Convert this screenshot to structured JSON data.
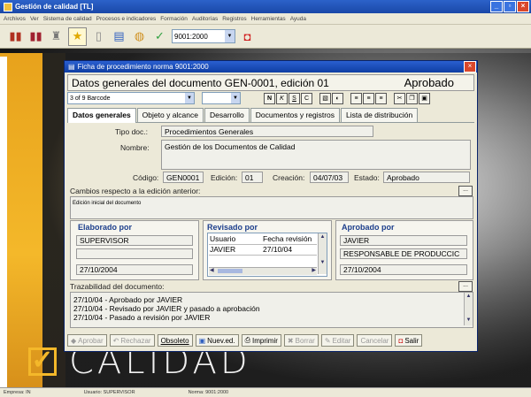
{
  "app": {
    "title": "Gestión de calidad [TL]",
    "menu": [
      "Archivos",
      "Ver",
      "Sistema de calidad",
      "Procesos e indicadores",
      "Formación",
      "Auditorías",
      "Registros",
      "Herramientas",
      "Ayuda"
    ],
    "toolbar_combo": "9001:2000",
    "status": [
      "Empresa: IN",
      "Usuario: SUPERVISOR",
      "Norma: 9001:2000"
    ],
    "brand_word": "CALIDAD",
    "accent": "#f4b82a"
  },
  "dialog": {
    "title": "Ficha de procedimiento norma 9001:2000",
    "heading": "Datos generales del documento GEN-0001, edición 01",
    "status": "Aprobado",
    "font_combo": "3 of 9 Barcode",
    "format_buttons": [
      "N",
      "K",
      "S",
      "C"
    ],
    "tabs": [
      "Datos generales",
      "Objeto y alcance",
      "Desarrollo",
      "Documentos y registros",
      "Lista de distribución"
    ],
    "fields": {
      "tipo_label": "Tipo doc.:",
      "tipo_value": "Procedimientos Generales",
      "nombre_label": "Nombre:",
      "nombre_value": "Gestión de los Documentos de Calidad",
      "codigo_label": "Código:",
      "codigo_value": "GEN0001",
      "edicion_label": "Edición:",
      "edicion_value": "01",
      "creacion_label": "Creación:",
      "creacion_value": "04/07/03",
      "estado_label": "Estado:",
      "estado_value": "Aprobado"
    },
    "cambios": {
      "label": "Cambios respecto a la edición anterior:",
      "value": "Edición inicial del documento",
      "btn": "..."
    },
    "elaborado": {
      "title": "Elaborado por",
      "name": "SUPERVISOR",
      "empty": "",
      "date": "27/10/2004"
    },
    "revisado": {
      "title": "Revisado por",
      "col1": "Usuario",
      "col2": "Fecha revisión",
      "row_user": "JAVIER",
      "row_date": "27/10/04"
    },
    "aprobado": {
      "title": "Aprobado por",
      "name": "JAVIER",
      "role": "RESPONSABLE DE PRODUCCIC",
      "date": "27/10/2004"
    },
    "trazabilidad": {
      "label": "Trazabilidad del documento:",
      "lines": [
        "27/10/04 - Aprobado por JAVIER",
        "27/10/04 - Revisado por JAVIER y pasado a aprobación",
        "27/10/04 - Pasado a revisión por JAVIER"
      ],
      "btn": "..."
    },
    "buttons": {
      "aprobar": "Aprobar",
      "rechazar": "Rechazar",
      "obsoleto": "Obsoleto",
      "nueved": "Nuev.ed.",
      "imprimir": "Imprimir",
      "borrar": "Borrar",
      "editar": "Editar",
      "cancelar": "Cancelar",
      "salir": "Salir"
    }
  }
}
